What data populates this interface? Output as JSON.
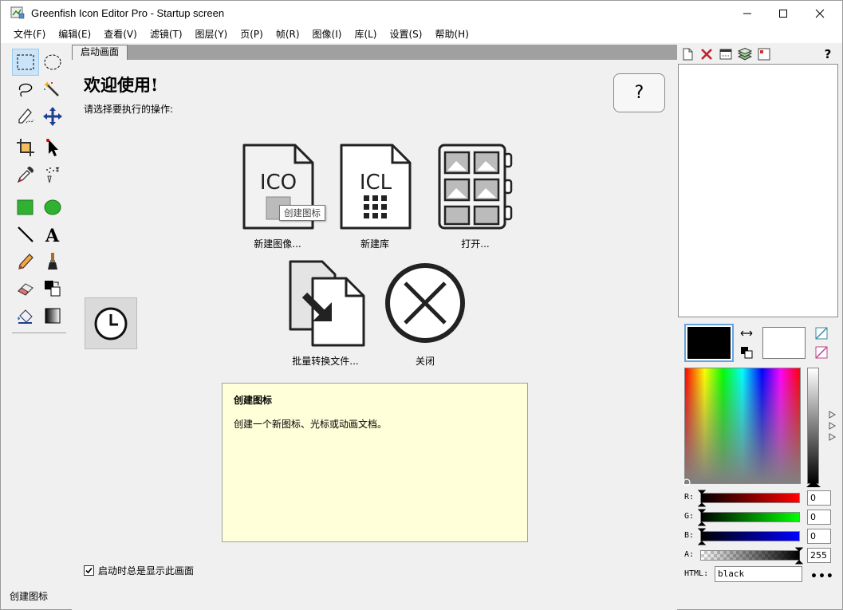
{
  "window": {
    "title": "Greenfish Icon Editor Pro - Startup screen"
  },
  "menu": [
    {
      "label": "文件(F)"
    },
    {
      "label": "编辑(E)"
    },
    {
      "label": "查看(V)"
    },
    {
      "label": "滤镜(T)"
    },
    {
      "label": "图层(Y)"
    },
    {
      "label": "页(P)"
    },
    {
      "label": "帧(R)"
    },
    {
      "label": "图像(I)"
    },
    {
      "label": "库(L)"
    },
    {
      "label": "设置(S)"
    },
    {
      "label": "帮助(H)"
    }
  ],
  "tools": [
    {
      "icon": "rect-select-icon"
    },
    {
      "icon": "ellipse-select-icon"
    },
    {
      "icon": "lasso-icon"
    },
    {
      "icon": "magic-wand-icon"
    },
    {
      "icon": "pen-path-icon"
    },
    {
      "icon": "move-icon"
    },
    {
      "icon": "crop-icon"
    },
    {
      "icon": "pointer-icon"
    },
    {
      "icon": "eyedropper-icon"
    },
    {
      "icon": "spray-icon"
    },
    {
      "icon": "rectangle-icon"
    },
    {
      "icon": "ellipse-icon"
    },
    {
      "icon": "line-icon"
    },
    {
      "icon": "text-icon"
    },
    {
      "icon": "pencil-icon"
    },
    {
      "icon": "brush-icon"
    },
    {
      "icon": "eraser-icon"
    },
    {
      "icon": "color-replace-icon"
    },
    {
      "icon": "fill-icon"
    },
    {
      "icon": "gradient-icon"
    }
  ],
  "tab": {
    "label": "启动画面"
  },
  "startup": {
    "title": "欢迎使用!",
    "subtitle": "请选择要执行的操作:",
    "help_label": "?",
    "actions": {
      "new_image": "新建图像...",
      "new_library": "新建库",
      "open": "打开...",
      "batch": "批量转换文件...",
      "close": "关闭"
    },
    "new_image_icon_text": "ICO",
    "new_library_icon_text": "ICL",
    "tooltip": "创建图标",
    "description": {
      "title": "创建图标",
      "text": "创建一个新图标、光标或动画文档。"
    },
    "show_on_startup": "启动时总是显示此画面"
  },
  "status": {
    "text": "创建图标"
  },
  "color": {
    "fg": "#000000",
    "bg": "#ffffff",
    "channels": [
      {
        "label": "R:",
        "value": "0"
      },
      {
        "label": "G:",
        "value": "0"
      },
      {
        "label": "B:",
        "value": "0"
      },
      {
        "label": "A:",
        "value": "255"
      }
    ],
    "html_label": "HTML:",
    "html_value": "black",
    "more_label": "•••"
  }
}
